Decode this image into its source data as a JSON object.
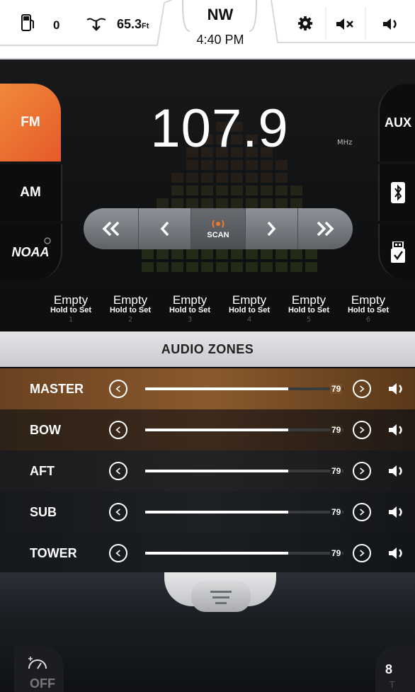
{
  "status_bar": {
    "fuel_value": "0",
    "depth_value": "65.3",
    "depth_unit": "Ft",
    "heading": "NW",
    "time": "4:40 PM",
    "icons": [
      "fuel-icon",
      "depth-icon",
      "gear-settings-icon",
      "mute-icon",
      "volume-icon"
    ]
  },
  "radio": {
    "bands": {
      "fm": "FM",
      "am": "AM",
      "noaa": "NOAA"
    },
    "sources": {
      "aux": "AUX"
    },
    "frequency": "107.9",
    "frequency_unit": "MHz",
    "tuner": {
      "scan_label": "SCAN"
    },
    "presets": [
      {
        "label": "Empty",
        "hint": "Hold to Set",
        "number": "1"
      },
      {
        "label": "Empty",
        "hint": "Hold to Set",
        "number": "2"
      },
      {
        "label": "Empty",
        "hint": "Hold to Set",
        "number": "3"
      },
      {
        "label": "Empty",
        "hint": "Hold to Set",
        "number": "4"
      },
      {
        "label": "Empty",
        "hint": "Hold to Set",
        "number": "5"
      },
      {
        "label": "Empty",
        "hint": "Hold to Set",
        "number": "6"
      }
    ]
  },
  "audio_zones": {
    "title": "AUDIO ZONES",
    "zones": [
      {
        "name": "MASTER",
        "value": "79",
        "level": 0.72
      },
      {
        "name": "BOW",
        "value": "79",
        "level": 0.72
      },
      {
        "name": "AFT",
        "value": "79",
        "level": 0.72
      },
      {
        "name": "SUB",
        "value": "79",
        "level": 0.72
      },
      {
        "name": "TOWER",
        "value": "79",
        "level": 0.72
      }
    ]
  },
  "bottom": {
    "cruise_label": "OFF",
    "gear_value": "8",
    "gear_sub": "T"
  },
  "colors": {
    "fm_active": "#e65a2a",
    "header_bg": "#d6d8db",
    "master_row": "#8a5a2e"
  }
}
